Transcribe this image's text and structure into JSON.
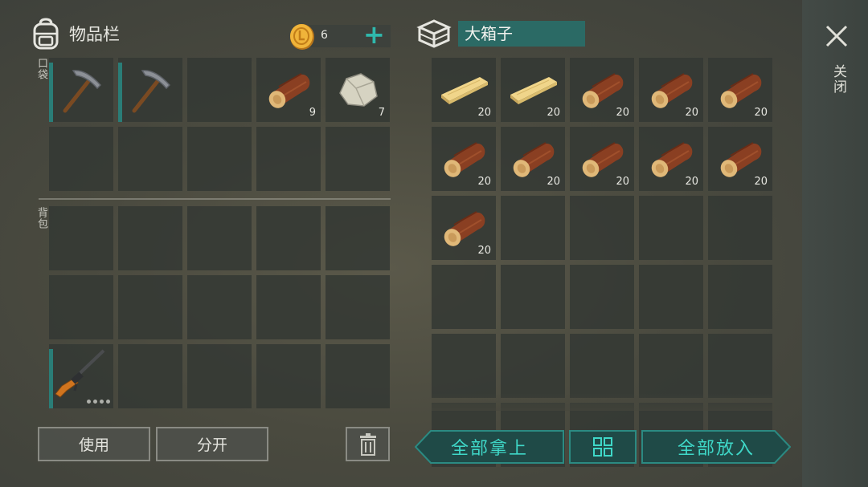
{
  "inventory": {
    "title": "物品栏",
    "coins": "6",
    "plus": "+",
    "pocket_label": "口袋",
    "backpack_label": "背包",
    "pocket_slots": [
      {
        "item": "pickaxe-icon",
        "qty": "",
        "bar": true
      },
      {
        "item": "pickaxe-icon",
        "qty": "",
        "bar": true
      },
      {
        "item": "",
        "qty": ""
      },
      {
        "item": "log-icon",
        "qty": "9"
      },
      {
        "item": "stone-icon",
        "qty": "7"
      },
      {
        "item": "",
        "qty": ""
      },
      {
        "item": "",
        "qty": ""
      },
      {
        "item": "",
        "qty": ""
      },
      {
        "item": "",
        "qty": ""
      },
      {
        "item": "",
        "qty": ""
      }
    ],
    "backpack_slots": [
      {
        "item": "",
        "qty": ""
      },
      {
        "item": "",
        "qty": ""
      },
      {
        "item": "",
        "qty": ""
      },
      {
        "item": "",
        "qty": ""
      },
      {
        "item": "",
        "qty": ""
      },
      {
        "item": "",
        "qty": ""
      },
      {
        "item": "",
        "qty": ""
      },
      {
        "item": "",
        "qty": ""
      },
      {
        "item": "",
        "qty": ""
      },
      {
        "item": "",
        "qty": ""
      },
      {
        "item": "rifle-icon",
        "qty": "",
        "bar": true,
        "dots": 4
      },
      {
        "item": "",
        "qty": ""
      },
      {
        "item": "",
        "qty": ""
      },
      {
        "item": "",
        "qty": ""
      },
      {
        "item": "",
        "qty": ""
      }
    ],
    "use_label": "使用",
    "split_label": "分开"
  },
  "container": {
    "title": "大箱子",
    "slots": [
      {
        "item": "plank-icon",
        "qty": "20"
      },
      {
        "item": "plank-icon",
        "qty": "20"
      },
      {
        "item": "log-icon",
        "qty": "20"
      },
      {
        "item": "log-icon",
        "qty": "20"
      },
      {
        "item": "log-icon",
        "qty": "20"
      },
      {
        "item": "log-icon",
        "qty": "20"
      },
      {
        "item": "log-icon",
        "qty": "20"
      },
      {
        "item": "log-icon",
        "qty": "20"
      },
      {
        "item": "log-icon",
        "qty": "20"
      },
      {
        "item": "log-icon",
        "qty": "20"
      },
      {
        "item": "log-icon",
        "qty": "20"
      },
      {
        "item": "",
        "qty": ""
      },
      {
        "item": "",
        "qty": ""
      },
      {
        "item": "",
        "qty": ""
      },
      {
        "item": "",
        "qty": ""
      },
      {
        "item": "",
        "qty": ""
      },
      {
        "item": "",
        "qty": ""
      },
      {
        "item": "",
        "qty": ""
      },
      {
        "item": "",
        "qty": ""
      },
      {
        "item": "",
        "qty": ""
      },
      {
        "item": "",
        "qty": ""
      },
      {
        "item": "",
        "qty": ""
      },
      {
        "item": "",
        "qty": ""
      },
      {
        "item": "",
        "qty": ""
      },
      {
        "item": "",
        "qty": ""
      },
      {
        "item": "",
        "qty": ""
      },
      {
        "item": "",
        "qty": ""
      },
      {
        "item": "",
        "qty": ""
      },
      {
        "item": "",
        "qty": ""
      },
      {
        "item": "",
        "qty": ""
      }
    ],
    "take_all_label": "全部拿上",
    "put_all_label": "全部放入"
  },
  "close_label": "关闭",
  "colors": {
    "accent": "#2fb8ac",
    "accent_text": "#3fd8c8",
    "slot_bar": "#2a7d77",
    "title_bg": "#2b6a65"
  }
}
